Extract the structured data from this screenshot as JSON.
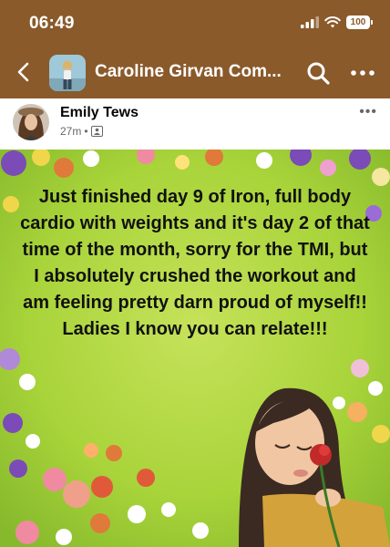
{
  "status_bar": {
    "time": "06:49",
    "battery": "100"
  },
  "nav": {
    "title": "Caroline Girvan Com..."
  },
  "post": {
    "author": "Emily Tews",
    "time_ago": "27m",
    "separator": "•",
    "image_text": "Just finished day 9 of Iron, full body cardio with weights and it's day 2 of that time of the month, sorry for the TMI, but I absolutely crushed the workout and am feeling pretty darn proud of myself!! Ladies I know you can relate!!!"
  },
  "colors": {
    "header": "#8a5a2b",
    "image_green": "#a9d43a"
  }
}
